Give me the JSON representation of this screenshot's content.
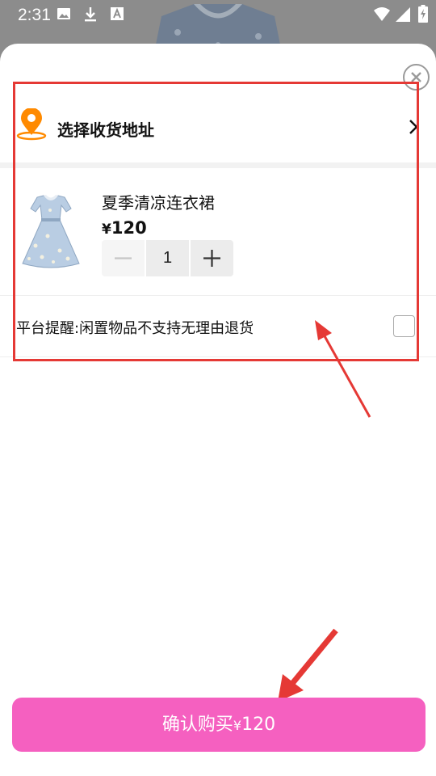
{
  "status_bar": {
    "time": "2:31",
    "icons": [
      "image-icon",
      "download-icon",
      "font-icon",
      "wifi-icon",
      "signal-icon",
      "battery-charging-icon"
    ]
  },
  "sheet": {
    "close_icon": "close-circle-icon",
    "address": {
      "label": "选择收货地址",
      "icon": "location-pin-icon",
      "pin_color": "#ff8a00"
    },
    "product": {
      "title": "夏季清凉连衣裙",
      "currency_symbol": "¥",
      "price": "120",
      "quantity": "1"
    },
    "notice": {
      "text": "平台提醒:闲置物品不支持无理由退货",
      "checked": false
    },
    "confirm": {
      "label": "确认购买",
      "currency_symbol": "¥",
      "amount": "120",
      "color": "#f560c0"
    }
  },
  "annotation": {
    "color": "#e53935"
  }
}
